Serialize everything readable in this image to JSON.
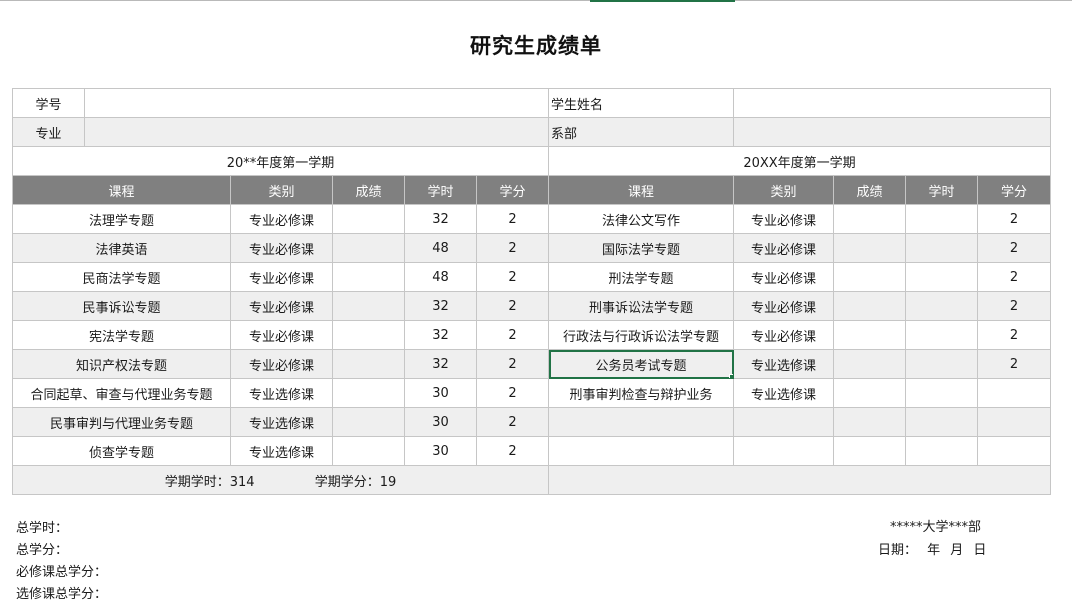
{
  "title": "研究生成绩单",
  "header": {
    "student_id_label": "学号",
    "student_id_value": "",
    "student_name_label": "学生姓名",
    "student_name_value": "",
    "major_label": "专业",
    "major_value": "",
    "dept_label": "系部",
    "dept_value": ""
  },
  "terms": [
    "20**年度第一学期",
    "20XX年度第一学期"
  ],
  "columns": [
    "课程",
    "类别",
    "成绩",
    "学时",
    "学分"
  ],
  "rows": [
    {
      "left": [
        "法理学专题",
        "专业必修课",
        "",
        "32",
        "2"
      ],
      "right": [
        "法律公文写作",
        "专业必修课",
        "",
        "",
        "2"
      ]
    },
    {
      "left": [
        "法律英语",
        "专业必修课",
        "",
        "48",
        "2"
      ],
      "right": [
        "国际法学专题",
        "专业必修课",
        "",
        "",
        "2"
      ]
    },
    {
      "left": [
        "民商法学专题",
        "专业必修课",
        "",
        "48",
        "2"
      ],
      "right": [
        "刑法学专题",
        "专业必修课",
        "",
        "",
        "2"
      ]
    },
    {
      "left": [
        "民事诉讼专题",
        "专业必修课",
        "",
        "32",
        "2"
      ],
      "right": [
        "刑事诉讼法学专题",
        "专业必修课",
        "",
        "",
        "2"
      ]
    },
    {
      "left": [
        "宪法学专题",
        "专业必修课",
        "",
        "32",
        "2"
      ],
      "right": [
        "行政法与行政诉讼法学专题",
        "专业必修课",
        "",
        "",
        "2"
      ]
    },
    {
      "left": [
        "知识产权法专题",
        "专业必修课",
        "",
        "32",
        "2"
      ],
      "right": [
        "公务员考试专题",
        "专业选修课",
        "",
        "",
        "2"
      ]
    },
    {
      "left": [
        "合同起草、审查与代理业务专题",
        "专业选修课",
        "",
        "30",
        "2"
      ],
      "right": [
        "刑事审判检查与辩护业务",
        "专业选修课",
        "",
        "",
        ""
      ]
    },
    {
      "left": [
        "民事审判与代理业务专题",
        "专业选修课",
        "",
        "30",
        "2"
      ],
      "right": [
        "",
        "",
        "",
        "",
        ""
      ]
    },
    {
      "left": [
        "侦查学专题",
        "专业选修课",
        "",
        "30",
        "2"
      ],
      "right": [
        "",
        "",
        "",
        "",
        ""
      ]
    }
  ],
  "summary": {
    "hours_text": "学期学时：314",
    "credits_text": "学期学分：19",
    "right_text": ""
  },
  "footer": {
    "total_hours": "总学时：",
    "total_credits": "总学分：",
    "required_credits": "必修课总学分：",
    "elective_credits": "选修课总学分：",
    "institution": "*****大学***部",
    "date": "日期： 年 月 日"
  },
  "colors": {
    "header_fill": "#808080",
    "shaded_row": "#efefef",
    "selection": "#217346",
    "border": "#c6c6c6"
  }
}
